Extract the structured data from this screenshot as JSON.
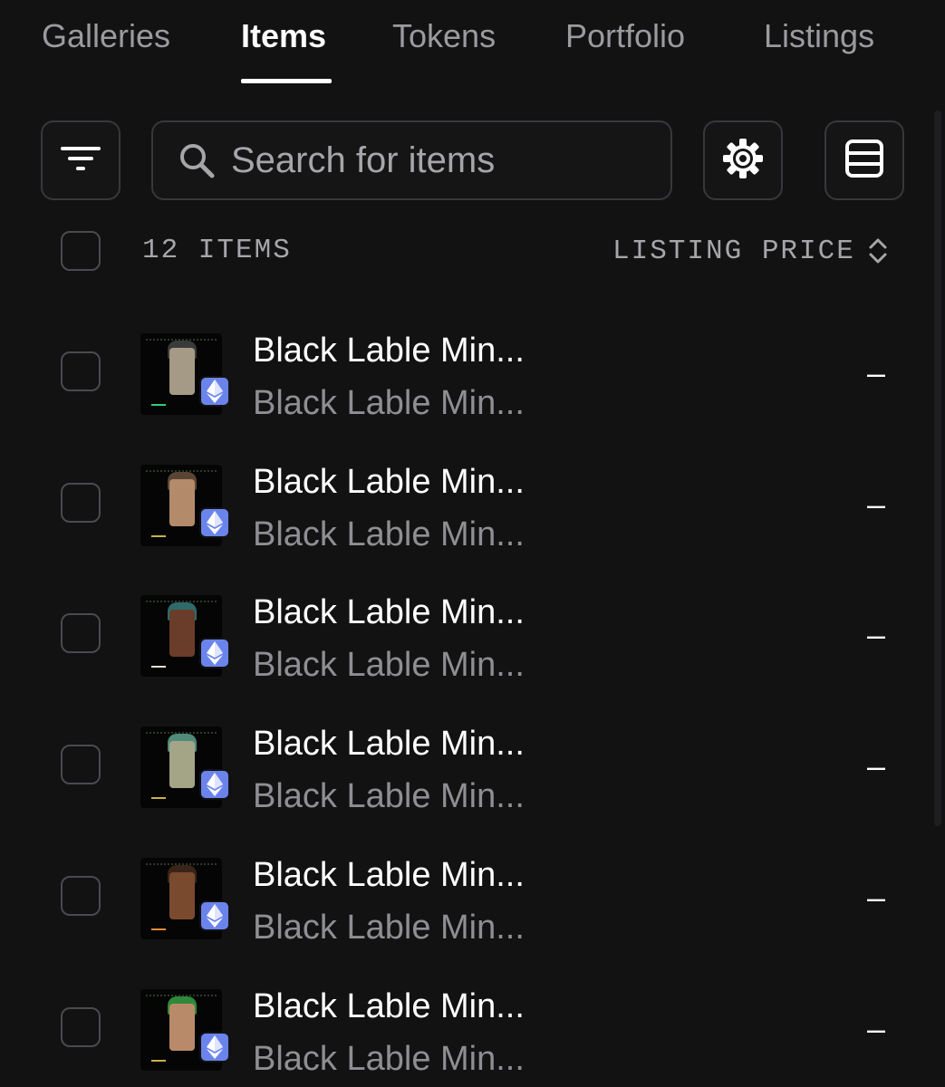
{
  "tabs": [
    {
      "label": "Galleries",
      "active": false
    },
    {
      "label": "Items",
      "active": true
    },
    {
      "label": "Tokens",
      "active": false
    },
    {
      "label": "Portfolio",
      "active": false
    },
    {
      "label": "Listings",
      "active": false
    }
  ],
  "toolbar": {
    "filter_icon": "filter-icon",
    "search_placeholder": "Search for items",
    "search_value": "",
    "settings_icon": "gear-icon",
    "view_icon": "list-view-icon"
  },
  "list_header": {
    "count_label": "12 ITEMS",
    "sort_label": "LISTING PRICE",
    "sort_icon": "sort-arrows-icon"
  },
  "items": [
    {
      "title": "Black Lable Min...",
      "subtitle": "Black Lable Min...",
      "price": "–",
      "chain_icon": "ethereum-icon",
      "skin": "#a49a86",
      "hair": "#3a3a3a",
      "accent": "#2ecf7a"
    },
    {
      "title": "Black Lable Min...",
      "subtitle": "Black Lable Min...",
      "price": "–",
      "chain_icon": "ethereum-icon",
      "skin": "#b38a6a",
      "hair": "#5a4535",
      "accent": "#c8b24a"
    },
    {
      "title": "Black Lable Min...",
      "subtitle": "Black Lable Min...",
      "price": "–",
      "chain_icon": "ethereum-icon",
      "skin": "#6a3c2a",
      "hair": "#2e6a6a",
      "accent": "#e8e0d0"
    },
    {
      "title": "Black Lable Min...",
      "subtitle": "Black Lable Min...",
      "price": "–",
      "chain_icon": "ethereum-icon",
      "skin": "#a4a487",
      "hair": "#4f8a7a",
      "accent": "#c8b24a"
    },
    {
      "title": "Black Lable Min...",
      "subtitle": "Black Lable Min...",
      "price": "–",
      "chain_icon": "ethereum-icon",
      "skin": "#7a4a2e",
      "hair": "#3a2418",
      "accent": "#e08a3a"
    },
    {
      "title": "Black Lable Min...",
      "subtitle": "Black Lable Min...",
      "price": "–",
      "chain_icon": "ethereum-icon",
      "skin": "#b88a6a",
      "hair": "#2e8a3a",
      "accent": "#c8b24a"
    }
  ],
  "colors": {
    "background": "#121213",
    "border": "#38383c",
    "muted_text": "#a6a6aa",
    "ethereum_badge": "#6b84ec"
  }
}
